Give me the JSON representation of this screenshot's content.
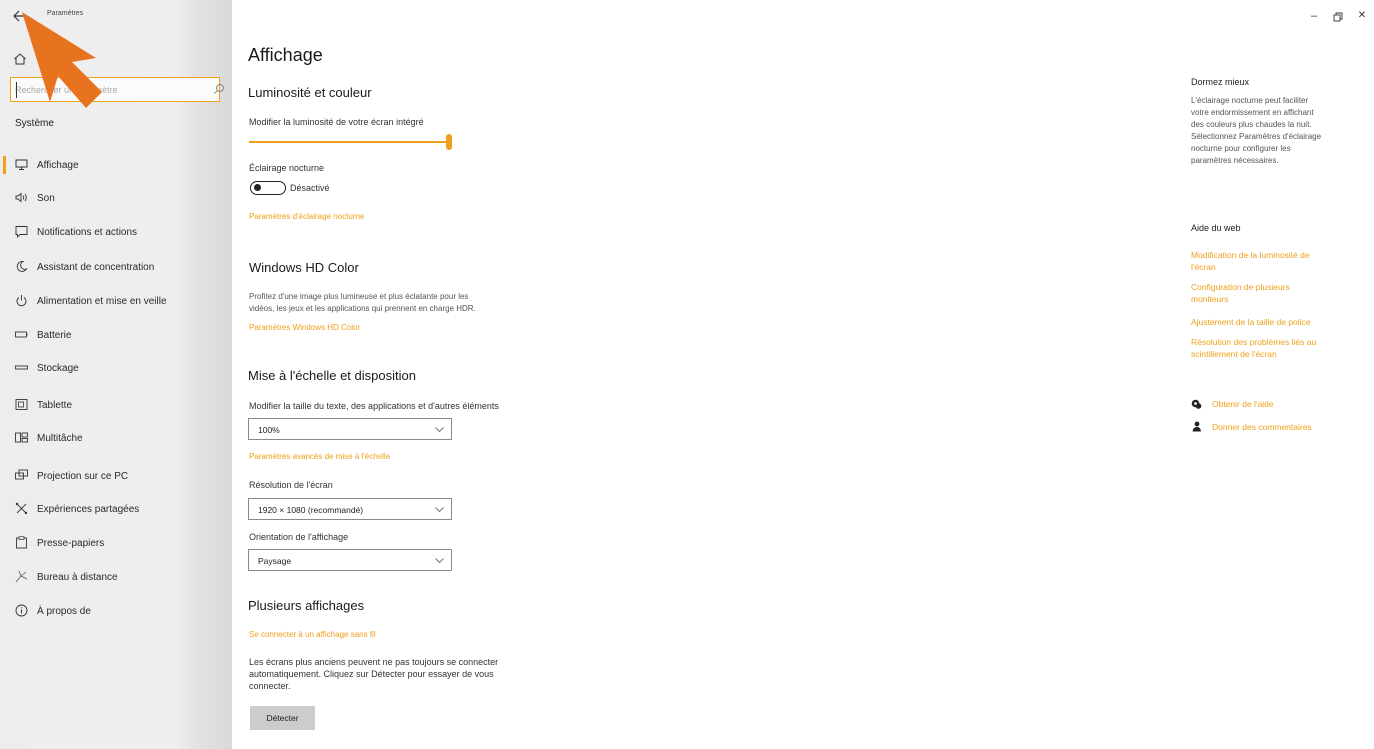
{
  "window": {
    "title": "Paramètres",
    "min_glyph": "–",
    "close_glyph": "✕"
  },
  "sidebar": {
    "search_placeholder": "Rechercher un paramètre",
    "section": "Système",
    "items": [
      {
        "label": "Affichage",
        "icon": "monitor-icon",
        "active": true
      },
      {
        "label": "Son",
        "icon": "speaker-icon"
      },
      {
        "label": "Notifications et actions",
        "icon": "notification-icon"
      },
      {
        "label": "Assistant de concentration",
        "icon": "moon-icon"
      },
      {
        "label": "Alimentation et mise en veille",
        "icon": "power-icon"
      },
      {
        "label": "Batterie",
        "icon": "battery-icon"
      },
      {
        "label": "Stockage",
        "icon": "storage-icon"
      },
      {
        "label": "Tablette",
        "icon": "tablet-icon"
      },
      {
        "label": "Multitâche",
        "icon": "multitask-icon"
      },
      {
        "label": "Projection sur ce PC",
        "icon": "projection-icon"
      },
      {
        "label": "Expériences partagées",
        "icon": "shared-icon"
      },
      {
        "label": "Presse-papiers",
        "icon": "clipboard-icon"
      },
      {
        "label": "Bureau à distance",
        "icon": "remote-desktop-icon"
      },
      {
        "label": "À propos de",
        "icon": "info-icon"
      }
    ]
  },
  "main": {
    "title": "Affichage",
    "brightness": {
      "heading": "Luminosité et couleur",
      "slider_label": "Modifier la luminosité de votre écran intégré",
      "slider_value": 1.0
    },
    "night_light": {
      "label": "Éclairage nocturne",
      "state": "Désactivé",
      "settings_link": "Paramètres d'éclairage nocturne"
    },
    "hdr": {
      "heading": "Windows HD Color",
      "desc_line1": "Profitez d'une image plus lumineuse et plus éclatante pour les",
      "desc_line2": "vidéos, les jeux et les applications qui prennent en charge HDR.",
      "link": "Paramètres Windows HD Color"
    },
    "scale": {
      "heading": "Mise à l'échelle et disposition",
      "size_label": "Modifier la taille du texte, des applications et d'autres éléments",
      "size_value": "100%",
      "advanced_link": "Paramètres avancés de mise à l'échelle",
      "resolution_label": "Résolution de l'écran",
      "resolution_value": "1920 × 1080 (recommandé)",
      "orientation_label": "Orientation de l'affichage",
      "orientation_value": "Paysage"
    },
    "multi": {
      "heading": "Plusieurs affichages",
      "wireless_link": "Se connecter à un affichage sans fil",
      "desc_line1": "Les écrans plus anciens peuvent ne pas toujours se connecter",
      "desc_line2": "automatiquement. Cliquez sur Détecter pour essayer de vous",
      "desc_line3": "connecter.",
      "detect_button": "Détecter"
    }
  },
  "right_pane": {
    "sleep_heading": "Dormez mieux",
    "sleep_lines": [
      "L'éclairage nocturne peut faciliter",
      "votre endormissement en affichant",
      "des couleurs plus chaudes la nuit.",
      "Sélectionnez Paramètres d'éclairage",
      "nocturne pour configurer les",
      "paramètres nécessaires."
    ],
    "web_heading": "Aide du web",
    "links": [
      [
        "Modification de la luminosité de",
        "l'écran"
      ],
      [
        "Configuration de plusieurs",
        "moniteurs"
      ],
      [
        "Ajustement de la taille de police"
      ],
      [
        "Résolution des problèmes liés au",
        "scintillement de l'écran"
      ]
    ],
    "get_help": "Obtenir de l'aide",
    "feedback": "Donner des commentaires"
  },
  "colors": {
    "accent": "#f0a01a",
    "arrow": "#e8731e"
  }
}
